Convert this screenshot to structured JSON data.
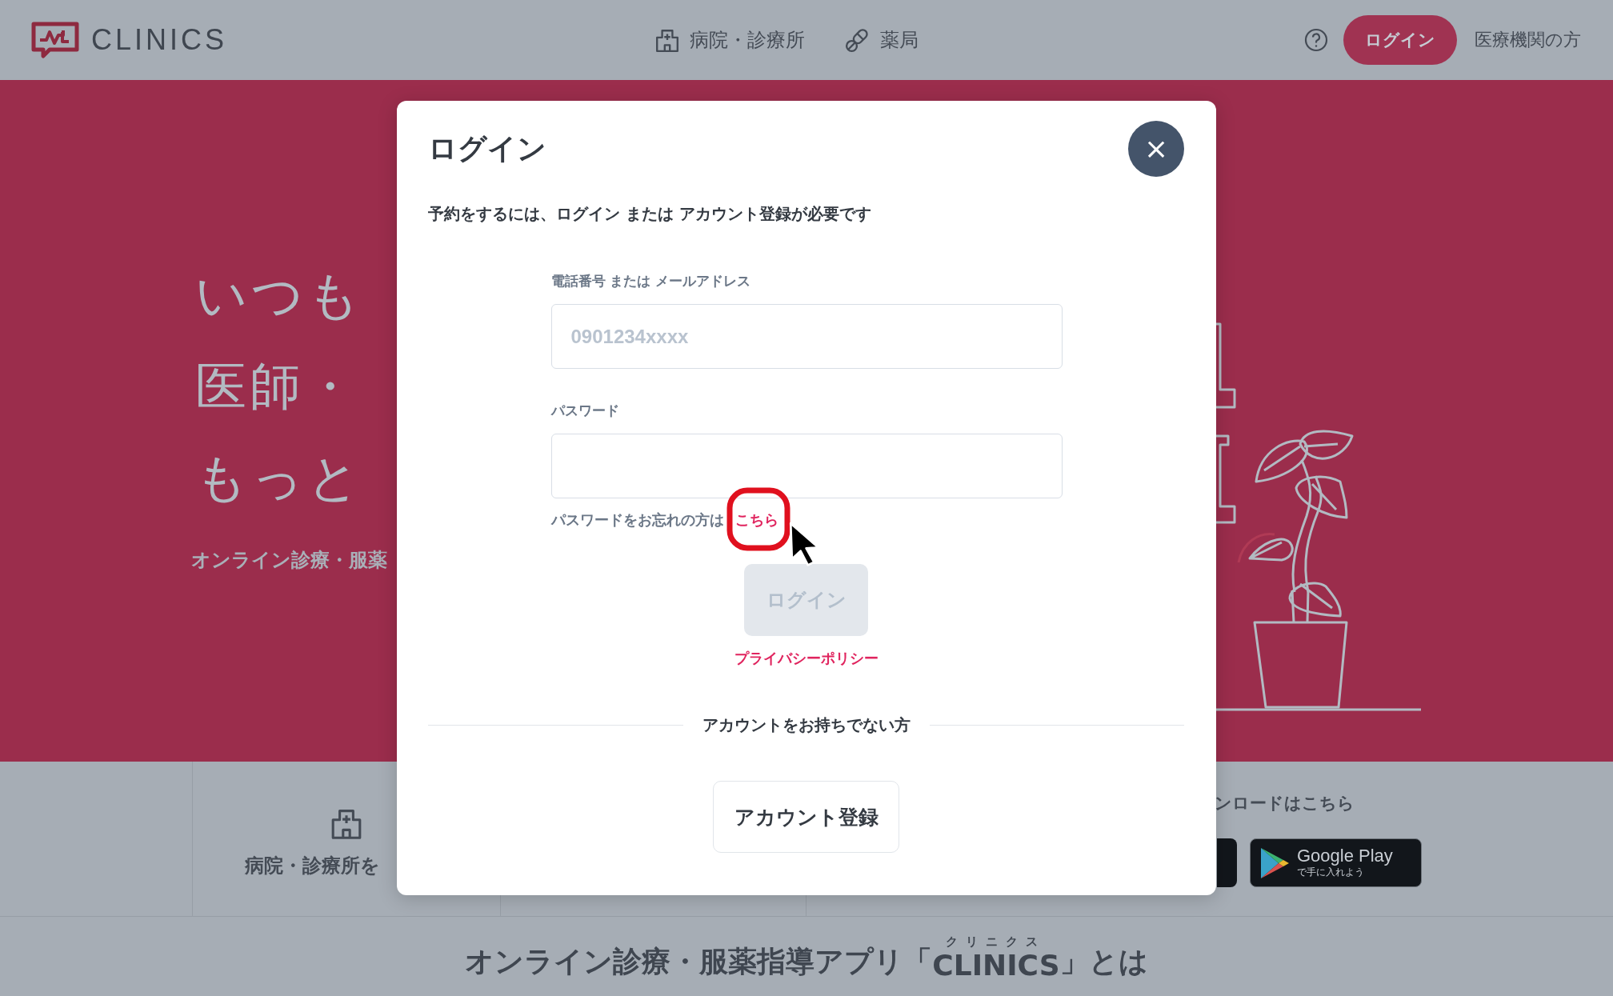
{
  "header": {
    "logo": "CLINICS",
    "nav": [
      {
        "label": "病院・診療所"
      },
      {
        "label": "薬局"
      }
    ],
    "login_button": "ログイン",
    "provider_link": "医療機関の方"
  },
  "hero": {
    "lines": [
      "いつも",
      "医師・",
      "もっと"
    ],
    "subtitle": "オンライン診療・服薬"
  },
  "features": {
    "hospital_label": "病院・診療所を",
    "download_label": "ンロードはこちら",
    "google_play": {
      "title": "Google Play",
      "subtitle": "で手に入れよう"
    }
  },
  "section": {
    "heading_before": "オンライン診療・服薬指導アプリ「",
    "brand": "CLINICS",
    "ruby": "クリニクス",
    "heading_after": "」とは"
  },
  "modal": {
    "title": "ログイン",
    "close": "×",
    "message": "予約をするには、ログイン または アカウント登録が必要です",
    "fields": [
      {
        "label": "電話番号 または メールアドレス",
        "placeholder": "0901234xxxx"
      },
      {
        "label": "パスワード"
      }
    ],
    "forgot_text": "パスワードをお忘れの方は",
    "forgot_link": "こちら",
    "login_button": {
      "label": "ログイン",
      "disabled": true
    },
    "privacy_link": "プライバシーポリシー",
    "no_account": "アカウントをお持ちでない方",
    "register_button": "アカウント登録"
  }
}
